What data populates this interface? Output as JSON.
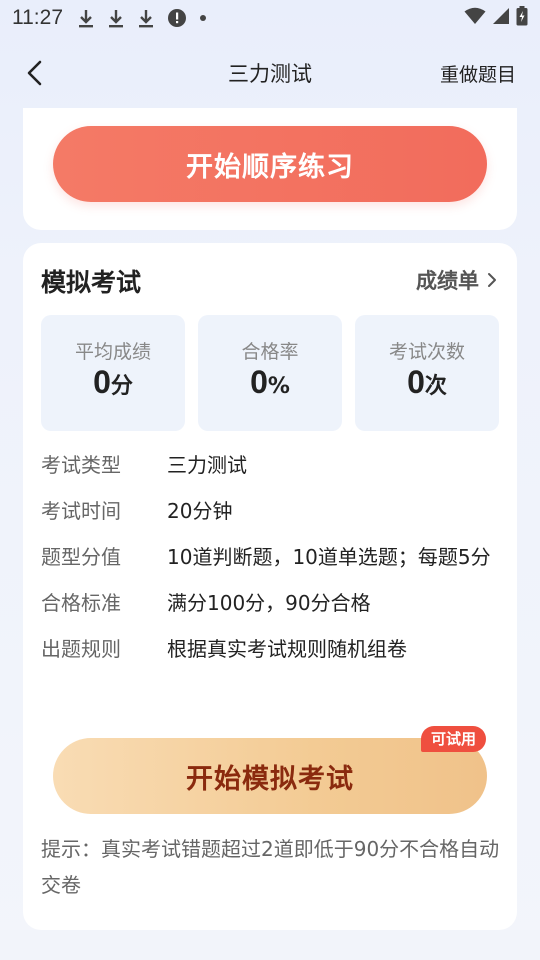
{
  "status_bar": {
    "time": "11:27",
    "icons": [
      "download-icon",
      "download-icon",
      "download-icon",
      "alert-icon",
      "dot-icon"
    ],
    "right_icons": [
      "wifi-icon",
      "signal-icon",
      "battery-icon"
    ]
  },
  "nav": {
    "title": "三力测试",
    "redo_label": "重做题目"
  },
  "practice": {
    "button_label": "开始顺序练习"
  },
  "exam": {
    "title": "模拟考试",
    "scores_link": "成绩单",
    "stats": [
      {
        "label": "平均成绩",
        "value": "0",
        "unit": "分"
      },
      {
        "label": "合格率",
        "value": "0",
        "unit": "%"
      },
      {
        "label": "考试次数",
        "value": "0",
        "unit": "次"
      }
    ],
    "info": [
      {
        "key": "考试类型",
        "value": "三力测试"
      },
      {
        "key": "考试时间",
        "value": "20分钟"
      },
      {
        "key": "题型分值",
        "value": "10道判断题，10道单选题；每题5分"
      },
      {
        "key": "合格标准",
        "value": "满分100分，90分合格"
      },
      {
        "key": "出题规则",
        "value": "根据真实考试规则随机组卷"
      }
    ],
    "start_button": "开始模拟考试",
    "badge": "可试用",
    "tip": "提示：真实考试错题超过2道即低于90分不合格自动交卷"
  },
  "colors": {
    "practice_button": "#f26c5c",
    "exam_button": "#f3cb94",
    "exam_button_text": "#8a2a0e",
    "badge": "#ef4f3f",
    "stat_bg": "#eef3fb"
  }
}
